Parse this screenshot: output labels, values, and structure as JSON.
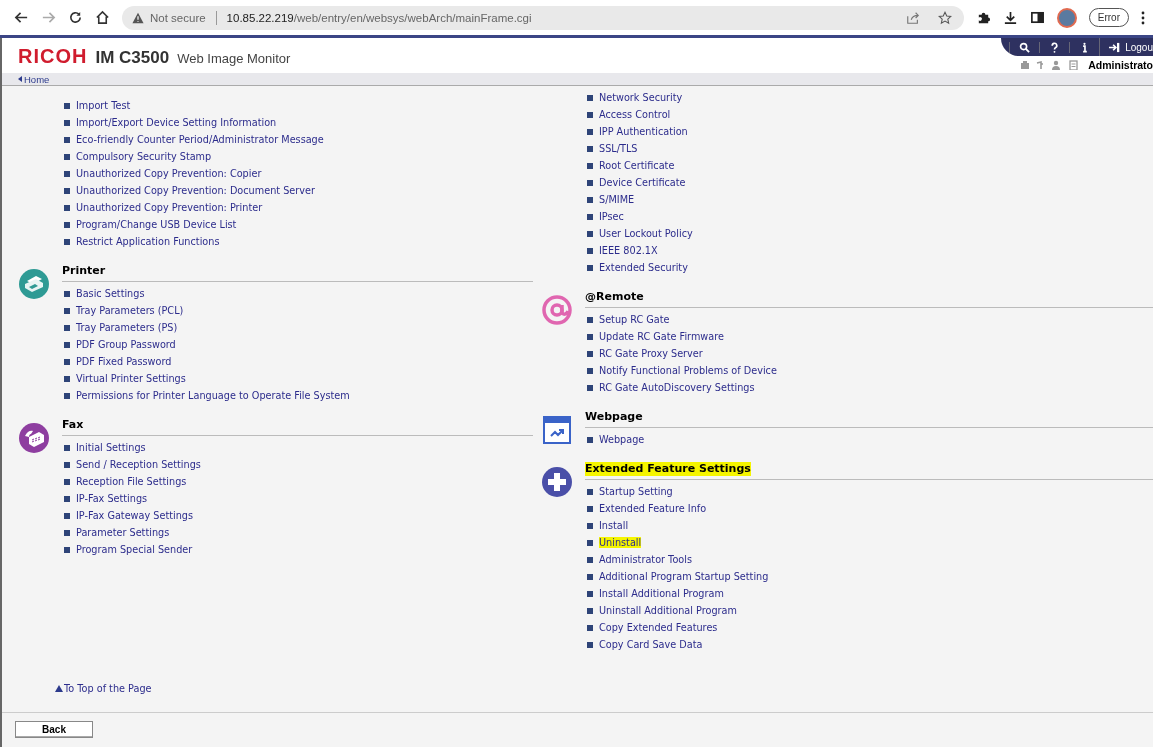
{
  "browser": {
    "security_label": "Not secure",
    "url_host": "10.85.22.219",
    "url_path": "/web/entry/en/websys/webArch/mainFrame.cgi",
    "profile_status": "Error"
  },
  "header": {
    "brand": "RICOH",
    "model": "IM C3500",
    "product": "Web Image Monitor",
    "logout": "Logou",
    "user": "Administrato"
  },
  "breadcrumb": "Home",
  "columns": [
    {
      "sections": [
        {
          "items": [
            {
              "label": "Import Test",
              "highlighted": false
            },
            {
              "label": "Import/Export Device Setting Information",
              "highlighted": false
            },
            {
              "label": "Eco-friendly Counter Period/Administrator Message",
              "highlighted": false
            },
            {
              "label": "Compulsory Security Stamp",
              "highlighted": false
            },
            {
              "label": "Unauthorized Copy Prevention: Copier",
              "highlighted": false
            },
            {
              "label": "Unauthorized Copy Prevention: Document Server",
              "highlighted": false
            },
            {
              "label": "Unauthorized Copy Prevention: Printer",
              "highlighted": false
            },
            {
              "label": "Program/Change USB Device List",
              "highlighted": false
            },
            {
              "label": "Restrict Application Functions",
              "highlighted": false
            }
          ]
        },
        {
          "title": "Printer",
          "highlighted": false,
          "items": [
            {
              "label": "Basic Settings",
              "highlighted": false
            },
            {
              "label": "Tray Parameters (PCL)",
              "highlighted": false
            },
            {
              "label": "Tray Parameters (PS)",
              "highlighted": false
            },
            {
              "label": "PDF Group Password",
              "highlighted": false
            },
            {
              "label": "PDF Fixed Password",
              "highlighted": false
            },
            {
              "label": "Virtual Printer Settings",
              "highlighted": false
            },
            {
              "label": "Permissions for Printer Language to Operate File System",
              "highlighted": false
            }
          ]
        },
        {
          "title": "Fax",
          "highlighted": false,
          "items": [
            {
              "label": "Initial Settings",
              "highlighted": false
            },
            {
              "label": "Send / Reception Settings",
              "highlighted": false
            },
            {
              "label": "Reception File Settings",
              "highlighted": false
            },
            {
              "label": "IP-Fax Settings",
              "highlighted": false
            },
            {
              "label": "IP-Fax Gateway Settings",
              "highlighted": false
            },
            {
              "label": "Parameter Settings",
              "highlighted": false
            },
            {
              "label": "Program Special Sender",
              "highlighted": false
            }
          ]
        }
      ]
    },
    {
      "sections": [
        {
          "items": [
            {
              "label": "Network Security",
              "highlighted": false
            },
            {
              "label": "Access Control",
              "highlighted": false
            },
            {
              "label": "IPP Authentication",
              "highlighted": false
            },
            {
              "label": "SSL/TLS",
              "highlighted": false
            },
            {
              "label": "Root Certificate",
              "highlighted": false
            },
            {
              "label": "Device Certificate",
              "highlighted": false
            },
            {
              "label": "S/MIME",
              "highlighted": false
            },
            {
              "label": "IPsec",
              "highlighted": false
            },
            {
              "label": "User Lockout Policy",
              "highlighted": false
            },
            {
              "label": "IEEE 802.1X",
              "highlighted": false
            },
            {
              "label": "Extended Security",
              "highlighted": false
            }
          ]
        },
        {
          "title": "@Remote",
          "highlighted": false,
          "items": [
            {
              "label": "Setup RC Gate",
              "highlighted": false
            },
            {
              "label": "Update RC Gate Firmware",
              "highlighted": false
            },
            {
              "label": "RC Gate Proxy Server",
              "highlighted": false
            },
            {
              "label": "Notify Functional Problems of Device",
              "highlighted": false
            },
            {
              "label": "RC Gate AutoDiscovery Settings",
              "highlighted": false
            }
          ]
        },
        {
          "title": "Webpage",
          "highlighted": false,
          "items": [
            {
              "label": "Webpage",
              "highlighted": false
            }
          ]
        },
        {
          "title": "Extended Feature Settings",
          "highlighted": true,
          "items": [
            {
              "label": "Startup Setting",
              "highlighted": false
            },
            {
              "label": "Extended Feature Info",
              "highlighted": false
            },
            {
              "label": "Install",
              "highlighted": false
            },
            {
              "label": "Uninstall",
              "highlighted": true
            },
            {
              "label": "Administrator Tools",
              "highlighted": false
            },
            {
              "label": "Additional Program Startup Setting",
              "highlighted": false
            },
            {
              "label": "Install Additional Program",
              "highlighted": false
            },
            {
              "label": "Uninstall Additional Program",
              "highlighted": false
            },
            {
              "label": "Copy Extended Features",
              "highlighted": false
            },
            {
              "label": "Copy Card Save Data",
              "highlighted": false
            }
          ]
        }
      ]
    }
  ],
  "footer": {
    "top_link": "To Top of the Page",
    "back_button": "Back"
  }
}
